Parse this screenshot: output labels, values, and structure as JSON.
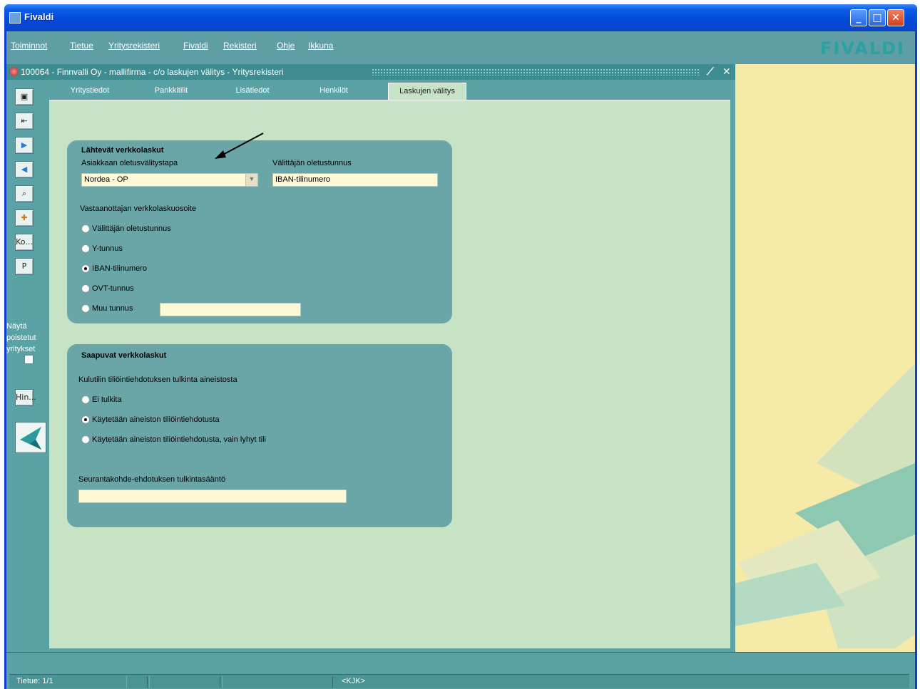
{
  "window": {
    "title": "Fivaldi"
  },
  "menu": {
    "items": [
      "Toiminnot",
      "Tietue",
      "Yritysrekisteri",
      "Fivaldi",
      "Rekisteri",
      "Ohje",
      "Ikkuna"
    ],
    "logo": "FIVALDI"
  },
  "form": {
    "title": "100064 - Finnvalli Oy - mallifirma - c/o laskujen välitys - Yritysrekisteri",
    "tabs": [
      "Yritystiedot",
      "Pankkitilit",
      "Lisätiedot",
      "Henkilöt",
      "Laskujen välitys"
    ],
    "active_tab": "Laskujen välitys"
  },
  "sidebar": {
    "buttons": [
      "save",
      "exit",
      "next",
      "previous",
      "search",
      "new",
      "Ko...",
      "P"
    ],
    "show_deleted_label": "Näytä poistetut yritykset",
    "hin_button": "Hin..."
  },
  "outgoing": {
    "title": "Lähtevät verkkolaskut",
    "default_method_label": "Asiakkaan oletusvälitystapa",
    "default_method_value": "Nordea - OP",
    "intermediary_id_label": "Välittäjän oletustunnus",
    "intermediary_id_value": "IBAN-tilinumero",
    "recipient_address_label": "Vastaanottajan verkkolaskuosoite",
    "options": [
      "Välittäjän oletustunnus",
      "Y-tunnus",
      "IBAN-tilinumero",
      "OVT-tunnus",
      "Muu tunnus"
    ],
    "selected": "IBAN-tilinumero",
    "other_value": ""
  },
  "incoming": {
    "title": "Saapuvat verkkolaskut",
    "interpretation_label": "Kulutilin tiliöintiehdotuksen tulkinta aineistosta",
    "options": [
      "Ei tulkita",
      "Käytetään aineiston tiliöintiehdotusta",
      "Käytetään aineiston tiliöintiehdotusta, vain lyhyt tili"
    ],
    "selected": "Käytetään aineiston tiliöintiehdotusta",
    "tracking_label": "Seurantakohde-ehdotuksen tulkintasääntö",
    "tracking_value": ""
  },
  "statusbar": {
    "record": "Tietue: 1/1",
    "mode": "<KJK>"
  }
}
